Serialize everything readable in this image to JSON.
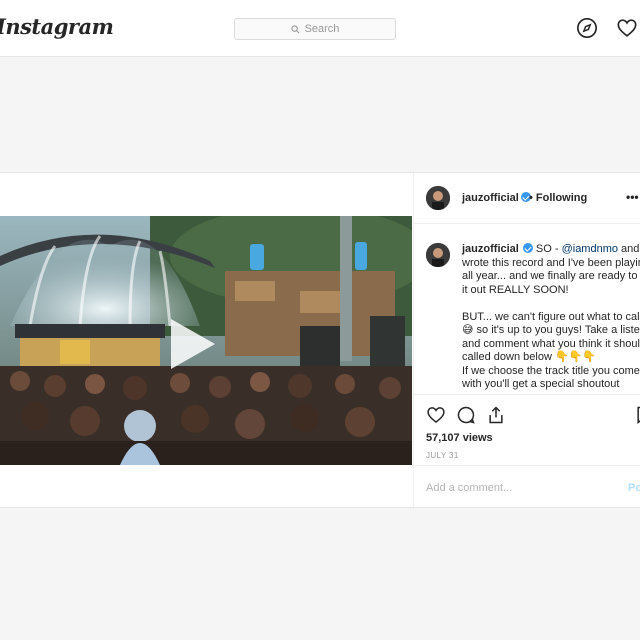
{
  "header": {
    "logo_text": "Instagram",
    "search_placeholder": "Search",
    "icons": [
      "search-icon",
      "compass-icon",
      "heart-icon"
    ]
  },
  "post": {
    "username": "jauzofficial",
    "follow_status": "• Following",
    "more_label": "•••",
    "caption_intro": "SO - ",
    "caption_mention": "@iamdnmo",
    "caption_body": " and I wrote this record and I've been playing it all year... and we finally are ready to put it out REALLY SOON!\n\nBUT... we can't figure out what to call it 😅 so it's up to you guys! Take a listen and comment what you think it should be called down below 👇👇👇\nIf we choose the track title you come up with you'll get a special shoutout",
    "views": "57,107 views",
    "date": "JULY 31",
    "comment_placeholder": "Add a comment...",
    "post_button": "Post",
    "media_icon": "play-icon"
  },
  "colors": {
    "accent": "#3897f0",
    "post_button": "#b2dffc",
    "mention": "#003569"
  }
}
